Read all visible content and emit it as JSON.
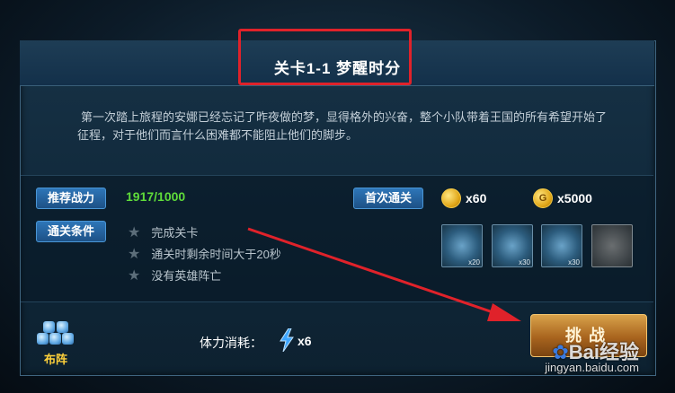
{
  "stage": {
    "title": "关卡1-1 梦醒时分",
    "description": "第一次踏上旅程的安娜已经忘记了昨夜做的梦，显得格外的兴奋，整个小队带着王国的所有希望开始了征程，对于他们而言什么困难都不能阻止他们的脚步。"
  },
  "recommended": {
    "label": "推荐战力",
    "value": "1917/1000"
  },
  "clear_conditions": {
    "label": "通关条件",
    "items": [
      "完成关卡",
      "通关时剩余时间大于20秒",
      "没有英雄阵亡"
    ]
  },
  "first_clear": {
    "label": "首次通关",
    "rewards": [
      {
        "icon": "diamond-coin-icon",
        "count": "x60"
      },
      {
        "icon": "gold-coin-icon",
        "glyph": "G",
        "count": "x5000"
      }
    ]
  },
  "item_slots": [
    {
      "qty": "x20"
    },
    {
      "qty": "x30"
    },
    {
      "qty": "x30"
    },
    {
      "qty": ""
    }
  ],
  "formation": {
    "label": "布阵"
  },
  "stamina": {
    "label": "体力消耗：",
    "value": "x6"
  },
  "challenge": {
    "label": "挑战"
  },
  "watermark": {
    "text": "Bai经验",
    "url": "jingyan.baidu.com"
  },
  "colors": {
    "accent_red": "#e0222a",
    "power_green": "#5fdc3a",
    "label_blue": "#2e76b8",
    "gold": "#ffd23b"
  }
}
